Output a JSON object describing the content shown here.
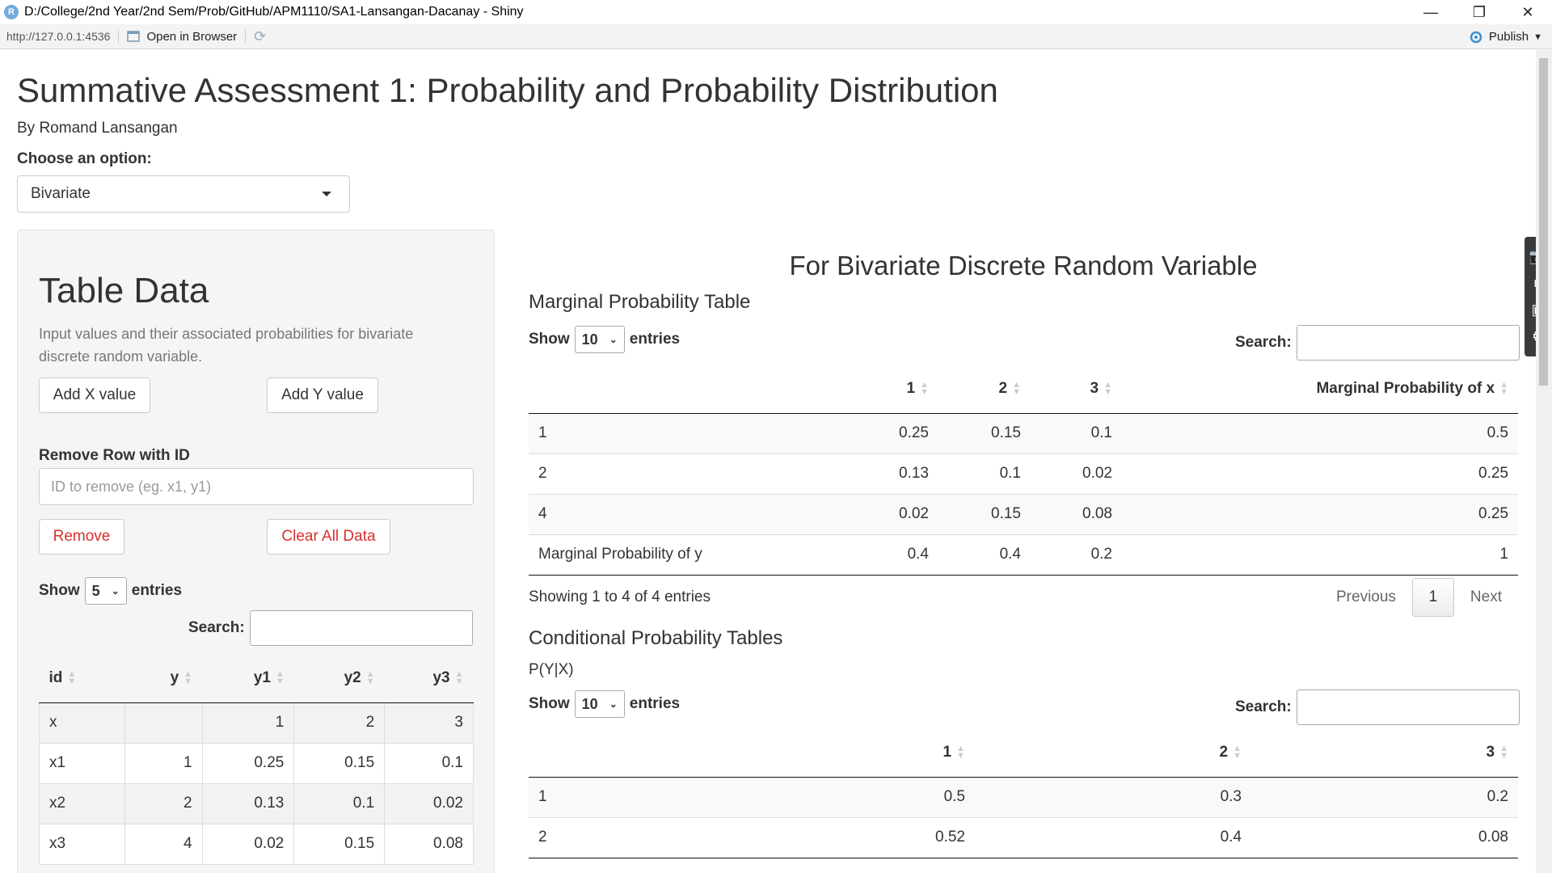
{
  "window": {
    "app_icon_letter": "R",
    "title": "D:/College/2nd Year/2nd Sem/Prob/GitHub/APM1110/SA1-Lansangan-Dacanay - Shiny",
    "minimize": "—",
    "restore": "❐",
    "close": "✕"
  },
  "toolbar": {
    "url": "http://127.0.0.1:4536",
    "open_in_browser": "Open in Browser",
    "publish": "Publish"
  },
  "page": {
    "title": "Summative Assessment 1: Probability and Probability Distribution",
    "author": "By Romand Lansangan",
    "choose_label": "Choose an option:",
    "selected_option": "Bivariate"
  },
  "sidebar": {
    "title": "Table Data",
    "description": "Input values and their associated probabilities for bivariate discrete random variable.",
    "add_x": "Add X value",
    "add_y": "Add Y value",
    "remove_label": "Remove Row with ID",
    "remove_placeholder": "ID to remove (eg. x1, y1)",
    "remove_button": "Remove",
    "clear_button": "Clear All Data",
    "show": "Show",
    "show_value": "5",
    "entries": "entries",
    "search": "Search:",
    "columns": [
      "id",
      "y",
      "y1",
      "y2",
      "y3"
    ],
    "rows": [
      [
        "x",
        "",
        "1",
        "2",
        "3"
      ],
      [
        "x1",
        "1",
        "0.25",
        "0.15",
        "0.1"
      ],
      [
        "x2",
        "2",
        "0.13",
        "0.1",
        "0.02"
      ],
      [
        "x3",
        "4",
        "0.02",
        "0.15",
        "0.08"
      ]
    ]
  },
  "main": {
    "heading": "For Bivariate Discrete Random Variable",
    "marginal": {
      "title": "Marginal Probability Table",
      "show": "Show",
      "show_value": "10",
      "entries": "entries",
      "search": "Search:",
      "columns": [
        "",
        "1",
        "2",
        "3",
        "Marginal Probability of x"
      ],
      "rows": [
        [
          "1",
          "0.25",
          "0.15",
          "0.1",
          "0.5"
        ],
        [
          "2",
          "0.13",
          "0.1",
          "0.02",
          "0.25"
        ],
        [
          "4",
          "0.02",
          "0.15",
          "0.08",
          "0.25"
        ],
        [
          "Marginal Probability of y",
          "0.4",
          "0.4",
          "0.2",
          "1"
        ]
      ],
      "info": "Showing 1 to 4 of 4 entries",
      "previous": "Previous",
      "page": "1",
      "next": "Next"
    },
    "conditional": {
      "title": "Conditional Probability Tables",
      "subtitle": "P(Y|X)",
      "show": "Show",
      "show_value": "10",
      "entries": "entries",
      "search": "Search:",
      "columns": [
        "",
        "1",
        "2",
        "3"
      ],
      "rows": [
        [
          "1",
          "0.5",
          "0.3",
          "0.2"
        ],
        [
          "2",
          "0.52",
          "0.4",
          "0.08"
        ]
      ]
    }
  }
}
